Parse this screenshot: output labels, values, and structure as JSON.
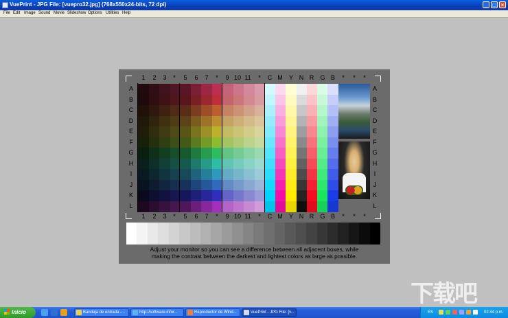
{
  "window": {
    "title": "VuePrint - JPG File: [vuepro32.jpg] (768x550x24-bits, 72 dpi)",
    "minimize": "_",
    "maximize": "□",
    "close": "×"
  },
  "menu": [
    "File",
    "Edit",
    "Image",
    "Sound",
    "Movie",
    "Slideshow",
    "Options",
    "Utilities",
    "Help"
  ],
  "chart": {
    "column_numbers": [
      "1",
      "2",
      "3",
      "*",
      "5",
      "6",
      "7",
      "*",
      "9",
      "10",
      "11",
      "*",
      "C",
      "M",
      "Y",
      "N",
      "R",
      "G",
      "B",
      "*",
      "*",
      "*"
    ],
    "row_letters": [
      "A",
      "B",
      "C",
      "D",
      "E",
      "F",
      "G",
      "H",
      "I",
      "J",
      "K",
      "L"
    ],
    "instructions_line1": "Adjust your monitor so you can see a difference between all adjacent boxes, while",
    "instructions_line2": "making the contrast between the darkest and lightest colors as large as possible."
  },
  "taskbar": {
    "start_label": "Inicio",
    "buttons": [
      {
        "label": "Bandeja de entrada -..."
      },
      {
        "label": "http://software.infor..."
      },
      {
        "label": "Reproductor de Wind..."
      },
      {
        "label": "VuePrint - JPG File: [v..."
      }
    ],
    "lang": "ES",
    "clock": "02:44 p.m."
  },
  "watermark": "下载吧"
}
